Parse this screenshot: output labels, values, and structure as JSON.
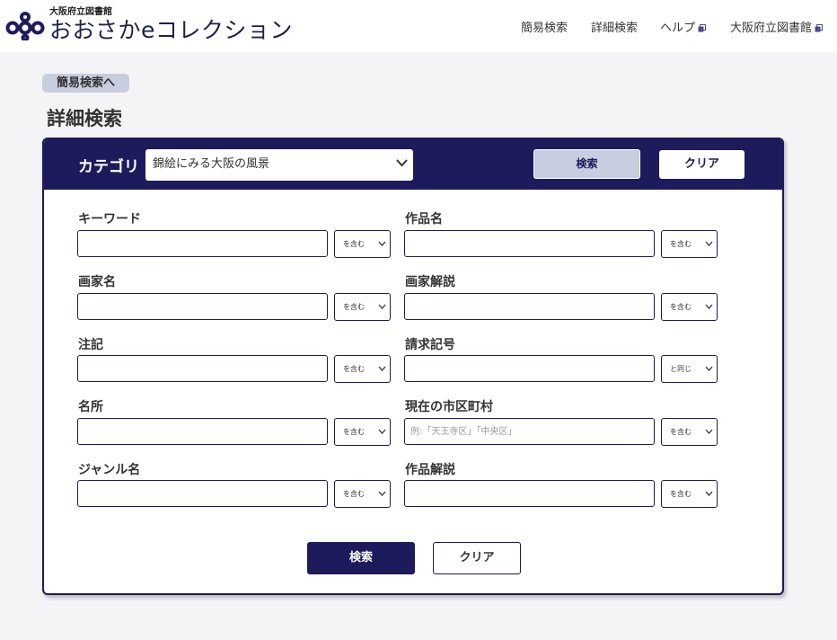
{
  "header": {
    "library_name": "大阪府立図書館",
    "site_name": "おおさかeコレクション",
    "nav": [
      {
        "label": "簡易検索",
        "external": false
      },
      {
        "label": "詳細検索",
        "external": false
      },
      {
        "label": "ヘルプ",
        "external": true
      },
      {
        "label": "大阪府立図書館",
        "external": true
      }
    ]
  },
  "back_link": "簡易検索へ",
  "page_title": "詳細検索",
  "category": {
    "label": "カテゴリ",
    "selected": "錦絵にみる大阪の風景",
    "search_button": "検索",
    "clear_button": "クリア"
  },
  "fields": [
    {
      "label": "キーワード",
      "value": "",
      "placeholder": "",
      "match": "を含む"
    },
    {
      "label": "作品名",
      "value": "",
      "placeholder": "",
      "match": "を含む"
    },
    {
      "label": "画家名",
      "value": "",
      "placeholder": "",
      "match": "を含む"
    },
    {
      "label": "画家解説",
      "value": "",
      "placeholder": "",
      "match": "を含む"
    },
    {
      "label": "注記",
      "value": "",
      "placeholder": "",
      "match": "を含む"
    },
    {
      "label": "請求記号",
      "value": "",
      "placeholder": "",
      "match": "と同じ"
    },
    {
      "label": "名所",
      "value": "",
      "placeholder": "",
      "match": "を含む"
    },
    {
      "label": "現在の市区町村",
      "value": "",
      "placeholder": "例:「天王寺区」「中央区」",
      "match": "を含む"
    },
    {
      "label": "ジャンル名",
      "value": "",
      "placeholder": "",
      "match": "を含む"
    },
    {
      "label": "作品解説",
      "value": "",
      "placeholder": "",
      "match": "を含む"
    }
  ],
  "bottom_buttons": {
    "search": "検索",
    "clear": "クリア"
  },
  "colors": {
    "navy": "#1d1b5c",
    "lavender": "#c9cde0",
    "page_bg": "#f4f4f6"
  }
}
